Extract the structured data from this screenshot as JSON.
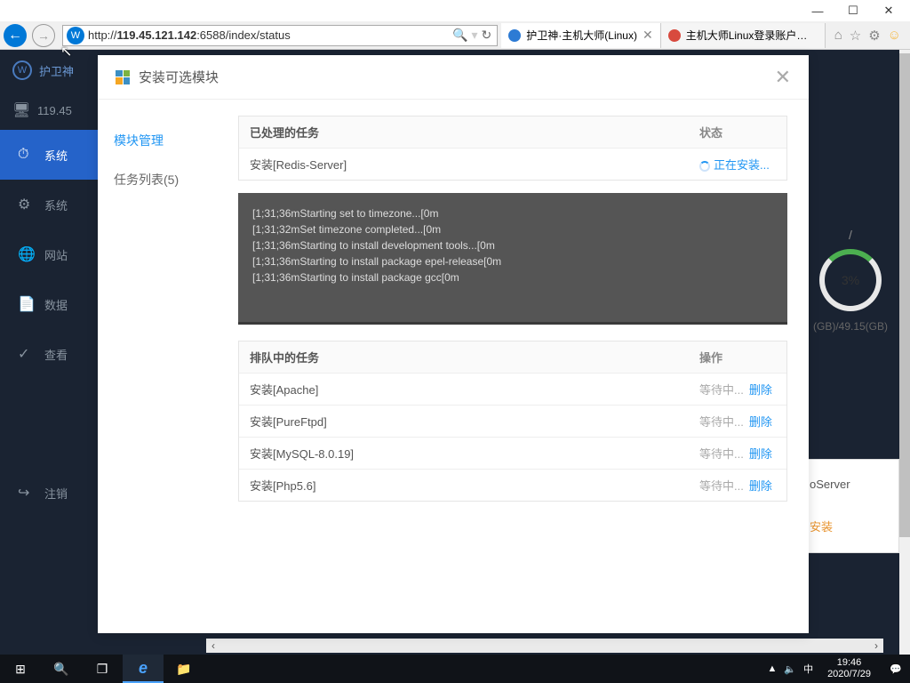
{
  "window": {
    "min": "—",
    "max": "☐",
    "close": "✕"
  },
  "browser": {
    "back": "←",
    "fwd": "→",
    "url_prefix": "http://",
    "url_host": "119.45.121.142",
    "url_rest": ":6588/index/status",
    "search_icon": "🔍",
    "refresh_icon": "↻",
    "tabs": [
      {
        "label": "护卫神·主机大师(Linux)",
        "close": "✕",
        "color": "#2d7bd4"
      },
      {
        "label": "主机大师Linux登录账户密码...",
        "close": "",
        "color": "#d84a3e"
      }
    ],
    "icons": [
      "⌂",
      "☆",
      "⚙",
      "☺"
    ]
  },
  "sidebar": {
    "brand": "护卫神",
    "ip": "119.45",
    "items": [
      {
        "icon": "⏱",
        "label": "系统"
      },
      {
        "icon": "⚙",
        "label": "系统"
      },
      {
        "icon": "🌐",
        "label": "网站"
      },
      {
        "icon": "📄",
        "label": "数据"
      },
      {
        "icon": "✓",
        "label": "查看"
      },
      {
        "icon": "↪",
        "label": "注销"
      }
    ]
  },
  "right": {
    "slash": "/",
    "percent": "3%",
    "gb": "(GB)/49.15(GB)",
    "server_label": "oServer",
    "install": "安装"
  },
  "modal": {
    "title": "安装可选模块",
    "close": "✕",
    "side": [
      {
        "label": "模块管理",
        "active": true
      },
      {
        "label": "任务列表(5)",
        "active": false
      }
    ],
    "processed_hdr": {
      "c1": "已处理的任务",
      "c2": "状态"
    },
    "processed_rows": [
      {
        "c1": "安装[Redis-Server]",
        "c2": "正在安装..."
      }
    ],
    "terminal_lines": [
      "[1;31;36mStarting set to timezone...[0m",
      "[1;31;32mSet timezone completed...[0m",
      "[1;31;36mStarting to install development tools...[0m",
      "[1;31;36mStarting to install package epel-release[0m",
      "[1;31;36mStarting to install package gcc[0m"
    ],
    "queued_hdr": {
      "c1": "排队中的任务",
      "c2": "操作"
    },
    "queued_rows": [
      {
        "c1": "安装[Apache]",
        "wait": "等待中...",
        "del": "删除"
      },
      {
        "c1": "安装[PureFtpd]",
        "wait": "等待中...",
        "del": "删除"
      },
      {
        "c1": "安装[MySQL-8.0.19]",
        "wait": "等待中...",
        "del": "删除"
      },
      {
        "c1": "安装[Php5.6]",
        "wait": "等待中...",
        "del": "删除"
      }
    ]
  },
  "taskbar": {
    "start": "⊞",
    "search": "🔍",
    "tasks": "❐",
    "ie": "e",
    "explorer": "📁",
    "tray": [
      "▲",
      "🔈",
      "中"
    ],
    "time": "19:46",
    "date": "2020/7/29",
    "notif": "💬"
  }
}
